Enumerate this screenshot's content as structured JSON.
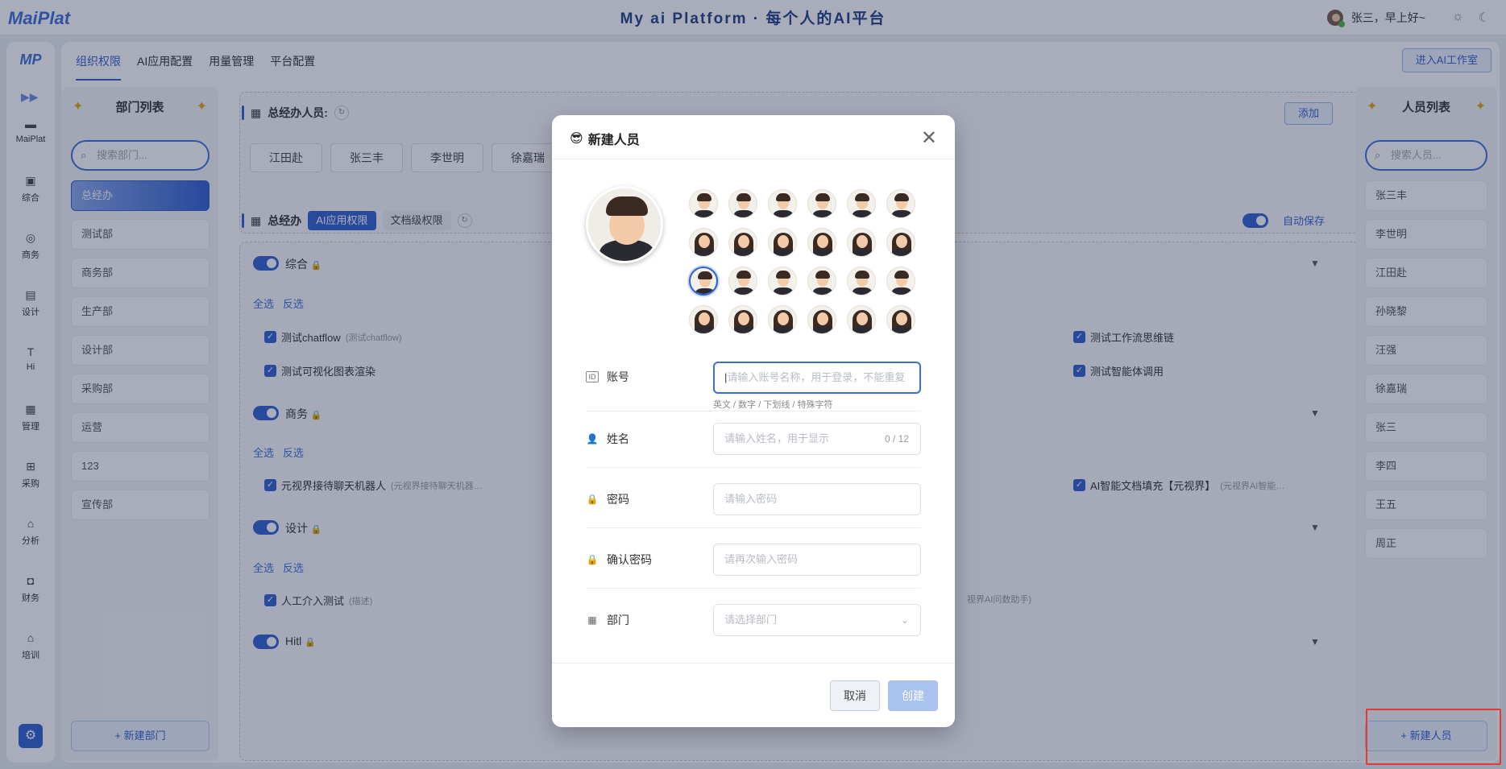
{
  "header": {
    "logo": "MaiPlat",
    "platform_title": "My ai Platform · 每个人的AI平台",
    "greeting": "张三，早上好~",
    "sun_icon": "☼",
    "moon_icon": "☾"
  },
  "rail": {
    "logo": "MP",
    "items": [
      {
        "label": "MaiPlat",
        "icon": "chat-bubble-icon"
      },
      {
        "label": "综合",
        "icon": "save-icon"
      },
      {
        "label": "商务",
        "icon": "headset-icon"
      },
      {
        "label": "设计",
        "icon": "document-icon"
      },
      {
        "label": "Hi",
        "icon": "text-icon"
      },
      {
        "label": "管理",
        "icon": "archive-icon"
      },
      {
        "label": "采购",
        "icon": "cart-icon"
      },
      {
        "label": "分析",
        "icon": "home-icon"
      },
      {
        "label": "财务",
        "icon": "lock-icon"
      },
      {
        "label": "培训",
        "icon": "home-icon"
      }
    ]
  },
  "tabs": [
    "组织权限",
    "AI应用配置",
    "用量管理",
    "平台配置"
  ],
  "enter_studio": "进入AI工作室",
  "dept_panel": {
    "title": "部门列表",
    "search_placeholder": "搜索部门...",
    "items": [
      "总经办",
      "测试部",
      "商务部",
      "生产部",
      "设计部",
      "采购部",
      "运营",
      "123",
      "宣传部"
    ],
    "new_dept": "+ 新建部门"
  },
  "members": {
    "label": "总经办人员:",
    "add": "添加",
    "chips": [
      "江田赴",
      "张三丰",
      "李世明",
      "徐嘉瑞"
    ]
  },
  "perm": {
    "dept": "总经办",
    "tab_ai": "AI应用权限",
    "tab_doc": "文档级权限",
    "autosave": "自动保存",
    "select_all": "全选",
    "invert": "反选",
    "sections": [
      {
        "title": "综合"
      },
      {
        "title": "商务"
      },
      {
        "title": "设计"
      },
      {
        "title": "Hitl"
      }
    ],
    "items": {
      "a1": {
        "name": "测试chatflow",
        "desc": "(测试chatflow)"
      },
      "a2": {
        "name": "测试工作流思维链",
        "desc": ""
      },
      "a3": {
        "name": "测试可视化图表渲染",
        "desc": ""
      },
      "a4": {
        "name": "测试智能体调用",
        "desc": ""
      },
      "b1": {
        "name": "元视界接待聊天机器人",
        "desc": "(元视界接待聊天机器…"
      },
      "b2": {
        "name": "AI智能文档填充【元视界】",
        "desc": "(元视界AI智能…"
      },
      "c1": {
        "name": "人工介入测试",
        "desc": "(描述)"
      },
      "c2": {
        "name": "",
        "desc": "视界AI问数助手)"
      }
    }
  },
  "people_panel": {
    "title": "人员列表",
    "search_placeholder": "搜索人员...",
    "items": [
      "张三丰",
      "李世明",
      "江田赴",
      "孙晓黎",
      "汪强",
      "徐嘉瑞",
      "张三",
      "李四",
      "王五",
      "周正"
    ],
    "new_person": "+ 新建人员"
  },
  "modal": {
    "title": "新建人员",
    "fields": {
      "account_label": "账号",
      "account_placeholder": "请输入账号名称，用于登录，不能重复",
      "account_hint": "英文 / 数字 / 下划线 / 特殊字符",
      "name_label": "姓名",
      "name_placeholder": "请输入姓名，用于显示",
      "name_counter": "0 / 12",
      "password_label": "密码",
      "password_placeholder": "请输入密码",
      "confirm_label": "确认密码",
      "confirm_placeholder": "请再次输入密码",
      "dept_label": "部门",
      "dept_placeholder": "请选择部门"
    },
    "id_badge": "ID",
    "cancel": "取消",
    "create": "创建",
    "selected_avatar_index": 12
  },
  "colors": {
    "accent": "#2f5fd0",
    "highlight": "#e53935",
    "lock": "#e6a700"
  }
}
